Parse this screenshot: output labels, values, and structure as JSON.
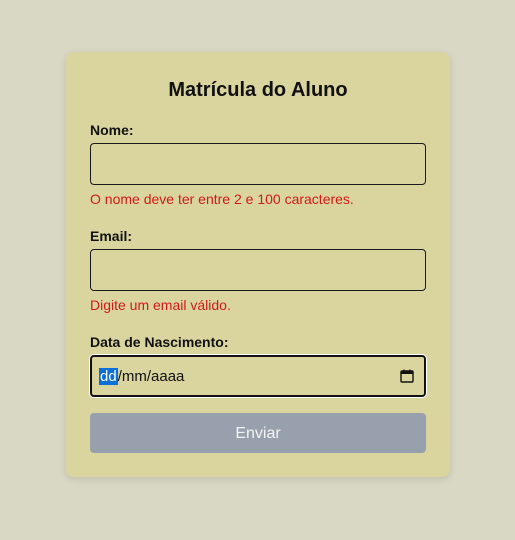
{
  "form": {
    "title": "Matrícula do Aluno",
    "name": {
      "label": "Nome:",
      "value": "",
      "error": "O nome deve ter entre 2 e 100 caracteres."
    },
    "email": {
      "label": "Email:",
      "value": "",
      "error": "Digite um email válido."
    },
    "birthdate": {
      "label": "Data de Nascimento:",
      "day_placeholder": "dd",
      "rest_placeholder": "/mm/aaaa",
      "icon": "calendar-icon"
    },
    "submit_label": "Enviar"
  },
  "colors": {
    "page_background": "#d9d8c4",
    "card_background": "#dad59f",
    "error_text": "#d11a1a",
    "button_background": "#98a0ad",
    "selection_highlight": "#0a6fd8"
  }
}
